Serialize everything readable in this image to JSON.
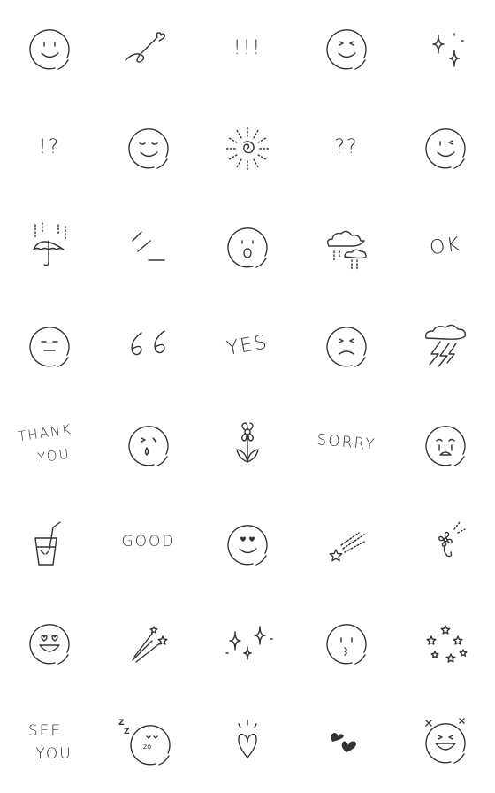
{
  "stroke_color": "#333333",
  "stickers": [
    {
      "icon": "smile-face-icon"
    },
    {
      "icon": "heart-swirl-icon"
    },
    {
      "icon": "text",
      "text": "!!!"
    },
    {
      "icon": "squint-smile-face-icon"
    },
    {
      "icon": "sparkles-icon"
    },
    {
      "icon": "text",
      "text": "!?"
    },
    {
      "icon": "content-face-icon"
    },
    {
      "icon": "sun-spiral-icon"
    },
    {
      "icon": "text",
      "text": "??"
    },
    {
      "icon": "wink-face-icon"
    },
    {
      "icon": "umbrella-rain-icon"
    },
    {
      "icon": "dash-lines-icon"
    },
    {
      "icon": "surprised-face-icon"
    },
    {
      "icon": "rain-clouds-icon"
    },
    {
      "icon": "text",
      "text": "OK",
      "rot": -8
    },
    {
      "icon": "flat-face-icon"
    },
    {
      "icon": "quote-66-icon"
    },
    {
      "icon": "text",
      "text": "YES",
      "rot": -10
    },
    {
      "icon": "frown-squint-face-icon"
    },
    {
      "icon": "storm-cloud-icon"
    },
    {
      "icon": "text2",
      "text": "THANK",
      "text2": "YOU",
      "rot": -8
    },
    {
      "icon": "wink-tear-face-icon"
    },
    {
      "icon": "flower-icon"
    },
    {
      "icon": "text",
      "text": "SORRY",
      "rot": 5,
      "small": true
    },
    {
      "icon": "crying-face-icon"
    },
    {
      "icon": "drink-icon"
    },
    {
      "icon": "text",
      "text": "GOOD",
      "small": true
    },
    {
      "icon": "heart-eyes-face-icon"
    },
    {
      "icon": "shooting-star-icon"
    },
    {
      "icon": "small-flower-icon"
    },
    {
      "icon": "heart-eyes-grin-face-icon"
    },
    {
      "icon": "shooting-stars-icon"
    },
    {
      "icon": "triple-sparkles-icon"
    },
    {
      "icon": "kiss-face-icon"
    },
    {
      "icon": "stars-cluster-icon"
    },
    {
      "icon": "text2",
      "text": "SEE",
      "text2": "YOU"
    },
    {
      "icon": "sleeping-face-icon",
      "text": "Z",
      "text2": "Z"
    },
    {
      "icon": "heart-icon"
    },
    {
      "icon": "black-hearts-icon"
    },
    {
      "icon": "grin-sparkle-face-icon"
    }
  ]
}
